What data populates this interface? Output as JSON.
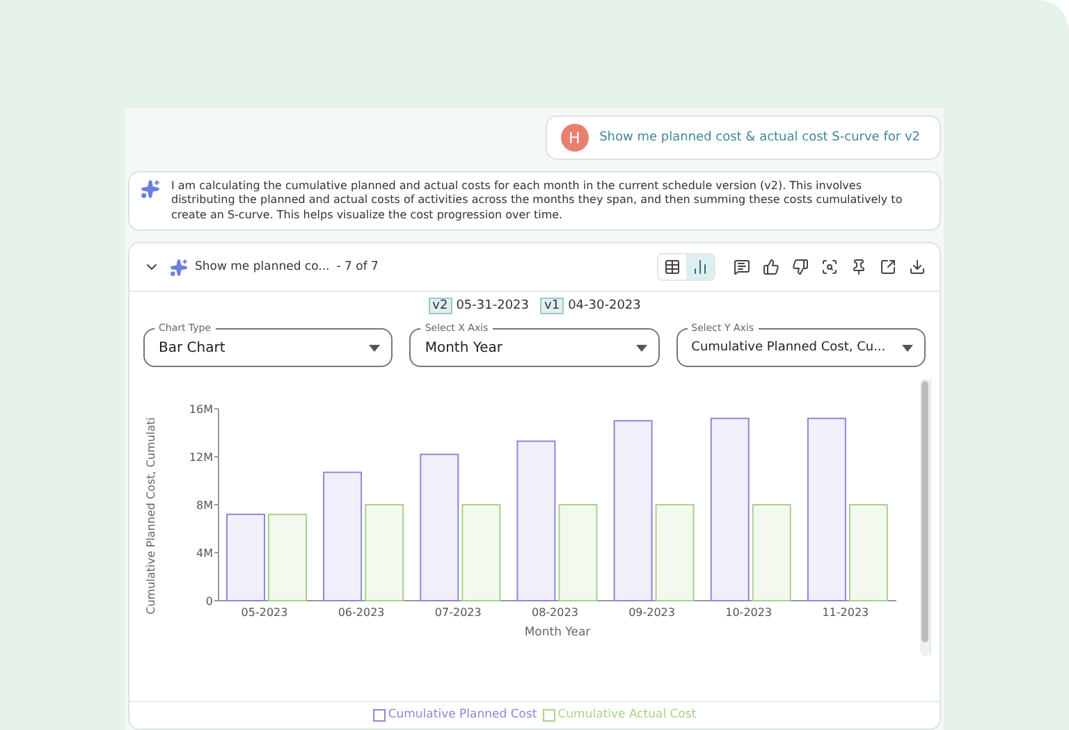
{
  "user_message": {
    "avatar": "H",
    "text": "Show me planned cost & actual cost S-curve for v2"
  },
  "assistant_message": {
    "text": "I am calculating the cumulative planned and actual costs for each month in the current schedule version (v2). This involves distributing the planned and actual costs of activities across the months they span, and then summing these costs cumulatively to create an S-curve. This helps visualize the cost progression over time."
  },
  "result_card": {
    "expanded": true,
    "title": "Show me planned co...",
    "counter": "- 7 of 7",
    "view_toggle": [
      {
        "kind": "table",
        "selected": false
      },
      {
        "kind": "chart",
        "selected": true
      }
    ],
    "actions": [
      {
        "kind": "comment"
      },
      {
        "kind": "thumbs_up"
      },
      {
        "kind": "thumbs_down"
      },
      {
        "kind": "inspect"
      },
      {
        "kind": "pin"
      },
      {
        "kind": "open_external"
      },
      {
        "kind": "download"
      }
    ],
    "versions": [
      {
        "tag": "v2",
        "date": "05-31-2023"
      },
      {
        "tag": "v1",
        "date": "04-30-2023"
      }
    ],
    "selects": [
      {
        "label": "Chart Type",
        "value": "Bar Chart"
      },
      {
        "label": "Select X Axis",
        "value": "Month Year"
      },
      {
        "label": "Select Y Axis",
        "value": "Cumulative Planned Cost, Cu..."
      }
    ],
    "chart_data": {
      "type": "bar",
      "xlabel": "Month Year",
      "ylabel": "Cumulative Planned Cost, Cumulati",
      "categories": [
        "05-2023",
        "06-2023",
        "07-2023",
        "08-2023",
        "09-2023",
        "10-2023",
        "11-2023"
      ],
      "series": [
        {
          "name": "Cumulative Planned Cost",
          "color": "#8f86d8",
          "values": [
            7200000,
            10700000,
            12200000,
            13300000,
            15000000,
            15200000,
            15200000
          ]
        },
        {
          "name": "Cumulative Actual Cost",
          "color": "#a6d38a",
          "values": [
            7200000,
            8000000,
            8000000,
            8000000,
            8000000,
            8000000,
            8000000
          ]
        }
      ],
      "ylim": [
        0,
        16000000
      ],
      "yticks": [
        {
          "value": 0,
          "label": "0"
        },
        {
          "value": 4000000,
          "label": "4M"
        },
        {
          "value": 8000000,
          "label": "8M"
        },
        {
          "value": 12000000,
          "label": "12M"
        },
        {
          "value": 16000000,
          "label": "16M"
        }
      ]
    }
  }
}
